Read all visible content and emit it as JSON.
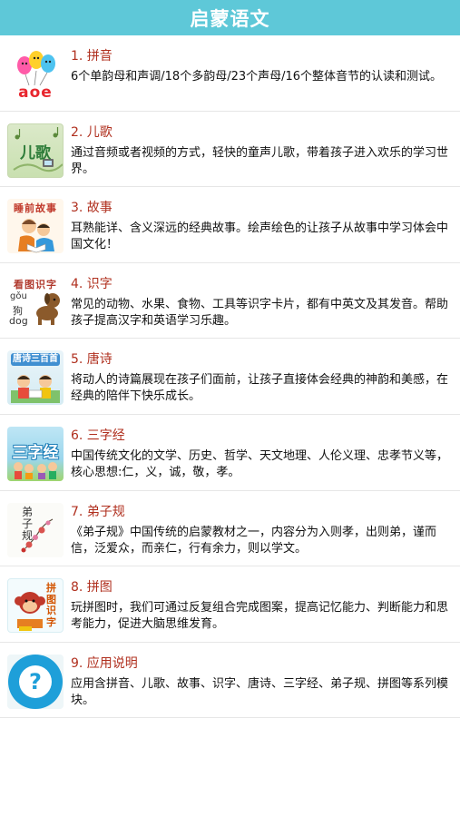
{
  "header": {
    "title": "启蒙语文"
  },
  "items": [
    {
      "title": "1. 拼音",
      "desc": "6个单韵母和声调/18个多韵母/23个声母/16个整体音节的认读和测试。",
      "thumb_text": "aoe"
    },
    {
      "title": "2. 儿歌",
      "desc": "通过音频或者视频的方式，轻快的童声儿歌，带着孩子进入欢乐的学习世界。",
      "thumb_text": "儿歌"
    },
    {
      "title": "3. 故事",
      "desc": "耳熟能详、含义深远的经典故事。绘声绘色的让孩子从故事中学习体会中国文化！",
      "thumb_text": "睡前故事"
    },
    {
      "title": "4. 识字",
      "desc": "常见的动物、水果、食物、工具等识字卡片，都有中英文及其发音。帮助孩子提高汉字和英语学习乐趣。",
      "thumb_text": "看图识字",
      "thumb_sub1": "gǒu",
      "thumb_sub2": "狗",
      "thumb_sub3": "dog"
    },
    {
      "title": "5. 唐诗",
      "desc": "将动人的诗篇展现在孩子们面前，让孩子直接体会经典的神韵和美感，在经典的陪伴下快乐成长。",
      "thumb_text": "唐诗三百首"
    },
    {
      "title": "6. 三字经",
      "desc": "中国传统文化的文学、历史、哲学、天文地理、人伦义理、忠孝节义等，核心思想:仁，义，诚，敬，孝。",
      "thumb_text": "三字经"
    },
    {
      "title": "7. 弟子规",
      "desc": "《弟子规》中国传统的启蒙教材之一，内容分为入则孝，出则弟，谨而信，泛爱众，而亲仁，行有余力，则以学文。",
      "thumb_text": "弟子规"
    },
    {
      "title": "8. 拼图",
      "desc": "玩拼图时，我们可通过反复组合完成图案，提高记忆能力、判断能力和思考能力，促进大脑思维发育。",
      "thumb_text": "拼图识字"
    },
    {
      "title": "9. 应用说明",
      "desc": "应用含拼音、儿歌、故事、识字、唐诗、三字经、弟子规、拼图等系列模块。",
      "thumb_text": "?"
    }
  ]
}
